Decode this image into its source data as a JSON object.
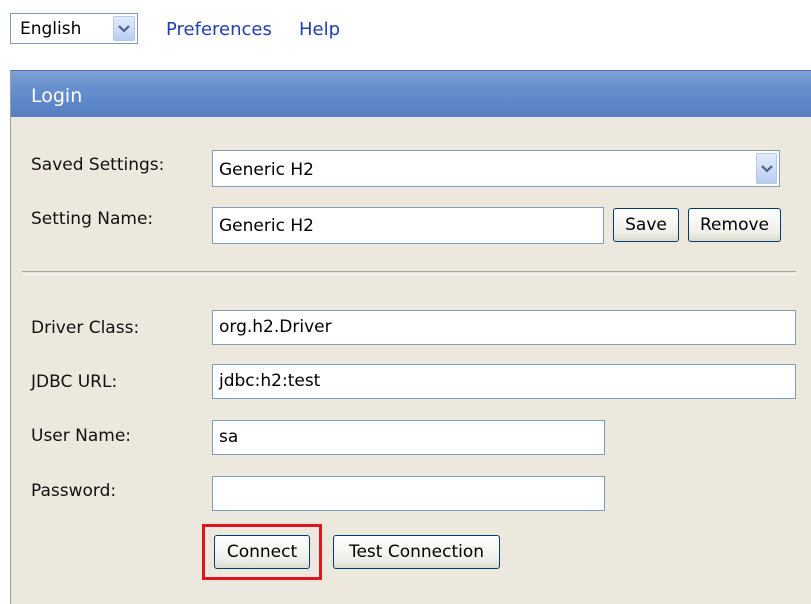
{
  "topbar": {
    "language": "English",
    "links": [
      "Preferences",
      "Help"
    ]
  },
  "panel": {
    "title": "Login"
  },
  "form": {
    "saved_settings_label": "Saved Settings:",
    "saved_settings_value": "Generic H2",
    "setting_name_label": "Setting Name:",
    "setting_name_value": "Generic H2",
    "save_button": "Save",
    "remove_button": "Remove",
    "driver_class_label": "Driver Class:",
    "driver_class_value": "org.h2.Driver",
    "jdbc_url_label": "JDBC URL:",
    "jdbc_url_value": "jdbc:h2:test",
    "user_name_label": "User Name:",
    "user_name_value": "sa",
    "password_label": "Password:",
    "password_value": "",
    "connect_button": "Connect",
    "test_connection_button": "Test Connection"
  },
  "icons": {
    "dropdown": "chevron-down-icon"
  },
  "colors": {
    "header_blue": "#6690cd",
    "panel_bg": "#ede8dd",
    "link": "#1f3fae",
    "highlight_red": "#e0141e"
  }
}
